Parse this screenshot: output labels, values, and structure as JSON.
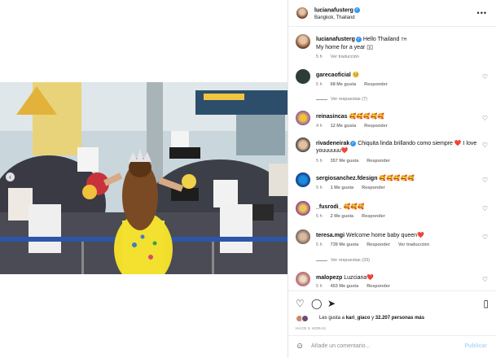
{
  "post": {
    "author": "lucianafusterg",
    "location": "Bangkok, Thailand",
    "caption_text": "Hello Thailand",
    "caption_line2": "My home for a year",
    "caption_time": "5 h",
    "see_translation": "Ver traducción"
  },
  "comments": [
    {
      "user": "garecaoficial",
      "text": "🥺",
      "time": "5 h",
      "likes": "68 Me gusta",
      "reply": "Responder",
      "translate": "",
      "replies": "Ver respuestas (7)"
    },
    {
      "user": "reinasincas",
      "text": "🥰🥰🥰🥰🥰",
      "time": "4 h",
      "likes": "12 Me gusta",
      "reply": "Responder",
      "translate": "",
      "replies": ""
    },
    {
      "user": "rivadeneirak",
      "text": "Chiquita linda brillando como siempre ❤️ I love youuuuuu❤️",
      "time": "5 h",
      "likes": "357 Me gusta",
      "reply": "Responder",
      "translate": "",
      "replies": ""
    },
    {
      "user": "sergiosanchez.fdesign",
      "text": "🥰🥰🥰🥰🥰",
      "time": "5 h",
      "likes": "1 Me gusta",
      "reply": "Responder",
      "translate": "",
      "replies": ""
    },
    {
      "user": "_fusrodi_",
      "text": "🥰🥰🥰",
      "time": "5 h",
      "likes": "2 Me gusta",
      "reply": "Responder",
      "translate": "",
      "replies": ""
    },
    {
      "user": "teresa.mgi",
      "text": "Welcome home baby queen❤️",
      "time": "5 h",
      "likes": "739 Me gusta",
      "reply": "Responder",
      "translate": "Ver traducción",
      "replies": "Ver respuestas (33)"
    },
    {
      "user": "malopezp",
      "text": "Luzciana❤️",
      "time": "5 h",
      "likes": "453 Me gusta",
      "reply": "Responder",
      "translate": "",
      "replies": ""
    }
  ],
  "actions": {
    "likes_prefix": "Les gusta a",
    "likes_user": "kari_giaco",
    "likes_mid": "y",
    "likes_count": "32.207 personas más",
    "time_ago": "HACE 5 HORAS"
  },
  "add_comment": {
    "placeholder": "Añade un comentario...",
    "publish": "Publicar"
  },
  "icons": {
    "more": "more-horizontal-icon",
    "heart": "heart-icon",
    "comment": "comment-icon",
    "share": "share-icon",
    "save": "bookmark-icon",
    "emoji": "emoji-icon",
    "verified": "verified-badge-icon",
    "prev": "chevron-left-icon"
  },
  "colors": {
    "verified": "#3897f0",
    "heart_red": "#ed4956",
    "link_blue": "#0095f6",
    "publish_disabled": "#b3d7fb"
  }
}
